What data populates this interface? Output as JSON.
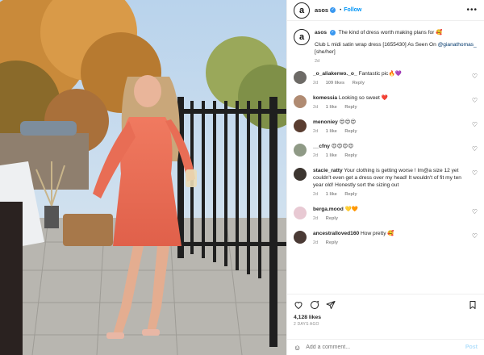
{
  "post": {
    "account": "asos",
    "follow_label": "Follow",
    "dot": "•",
    "more": "•••",
    "logo_letter": "a"
  },
  "caption": {
    "user": "asos",
    "line1": "The kind of dress worth making plans for 🥰",
    "line2_prefix": "Club L midi satin wrap dress [1655430] As Seen On ",
    "mention": "@gianathomas_",
    "line3": "[she/her]",
    "time": "2d"
  },
  "comments": [
    {
      "user": "_o_aliakerwo._o_",
      "text": "Fantastic pic🔥💜",
      "time": "2d",
      "likes": "109 likes",
      "reply": "Reply",
      "avatar_color": "#6d6a66"
    },
    {
      "user": "komessia",
      "text": "Looking so sweet ❤️",
      "time": "2d",
      "likes": "1 like",
      "reply": "Reply",
      "avatar_color": "#b08b72"
    },
    {
      "user": "menoniey",
      "text": "😍😍😍",
      "time": "2d",
      "likes": "1 like",
      "reply": "Reply",
      "avatar_color": "#5a3d30"
    },
    {
      "user": "__cfny",
      "text": "😍😍😍😍",
      "time": "2d",
      "likes": "1 like",
      "reply": "Reply",
      "avatar_color": "#8f9a86"
    },
    {
      "user": "stacie_ratty",
      "text": "Your clothing is getting worse ! Im@a size 12 yet couldn't even get a dress over my head! It wouldn't of fit my ten year old! Honestly sort the sizing out",
      "time": "2d",
      "likes": "1 like",
      "reply": "Reply",
      "avatar_color": "#3c3530"
    },
    {
      "user": "berga.mood",
      "text": "💛🧡",
      "time": "2d",
      "likes": "",
      "reply": "Reply",
      "avatar_color": "#e8c9d3"
    },
    {
      "user": "ancestralloved160",
      "text": "How pretty 🥰",
      "time": "2d",
      "likes": "",
      "reply": "Reply",
      "avatar_color": "#4a3a35"
    }
  ],
  "actions": {
    "likes": "4,128 likes",
    "ago": "2 DAYS AGO"
  },
  "add_comment": {
    "placeholder": "Add a comment...",
    "post_label": "Post"
  }
}
